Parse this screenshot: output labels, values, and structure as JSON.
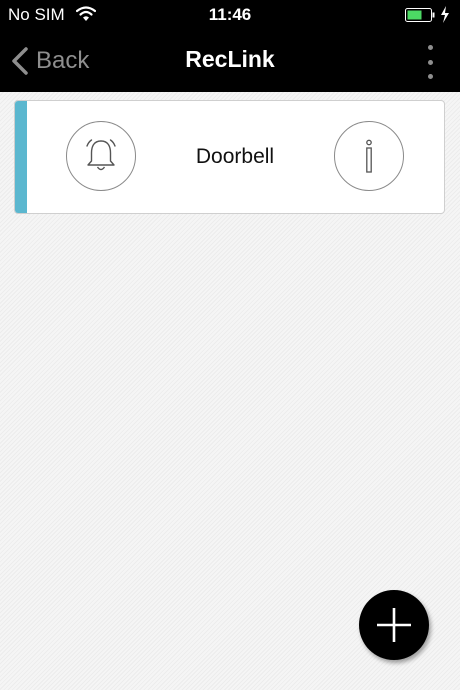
{
  "status_bar": {
    "carrier": "No SIM",
    "time": "11:46",
    "wifi_icon": "wifi-icon",
    "battery_icon": "battery-charging-icon",
    "battery_color": "#4cd964"
  },
  "nav_bar": {
    "back_label": "Back",
    "title": "RecLink",
    "menu_icon": "more-vertical-icon"
  },
  "devices": [
    {
      "name": "Doorbell",
      "left_icon": "bell-icon",
      "right_icon": "info-icon",
      "accent_color": "#5bb7cf"
    }
  ],
  "fab": {
    "icon": "plus-icon"
  }
}
